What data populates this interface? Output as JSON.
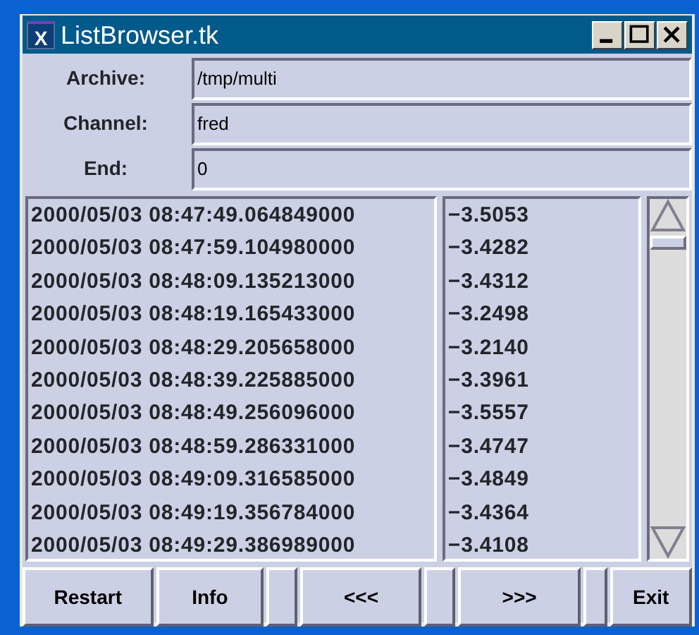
{
  "window": {
    "icon": "X",
    "title": "ListBrowser.tk"
  },
  "fields": [
    {
      "label": "Archive:",
      "value": "/tmp/multi"
    },
    {
      "label": "Channel:",
      "value": "fred"
    },
    {
      "label": "End:",
      "value": "0"
    }
  ],
  "rows": [
    {
      "time": "2000/05/03 08:47:49.064849000",
      "value": "−3.5053"
    },
    {
      "time": "2000/05/03 08:47:59.104980000",
      "value": "−3.4282"
    },
    {
      "time": "2000/05/03 08:48:09.135213000",
      "value": "−3.4312"
    },
    {
      "time": "2000/05/03 08:48:19.165433000",
      "value": "−3.2498"
    },
    {
      "time": "2000/05/03 08:48:29.205658000",
      "value": "−3.2140"
    },
    {
      "time": "2000/05/03 08:48:39.225885000",
      "value": "−3.3961"
    },
    {
      "time": "2000/05/03 08:48:49.256096000",
      "value": "−3.5557"
    },
    {
      "time": "2000/05/03 08:48:59.286331000",
      "value": "−3.4747"
    },
    {
      "time": "2000/05/03 08:49:09.316585000",
      "value": "−3.4849"
    },
    {
      "time": "2000/05/03 08:49:19.356784000",
      "value": "−3.4364"
    },
    {
      "time": "2000/05/03 08:49:29.386989000",
      "value": "−3.4108"
    }
  ],
  "buttons": [
    "Restart",
    "Info",
    "<<<",
    ">>>",
    "Exit"
  ]
}
